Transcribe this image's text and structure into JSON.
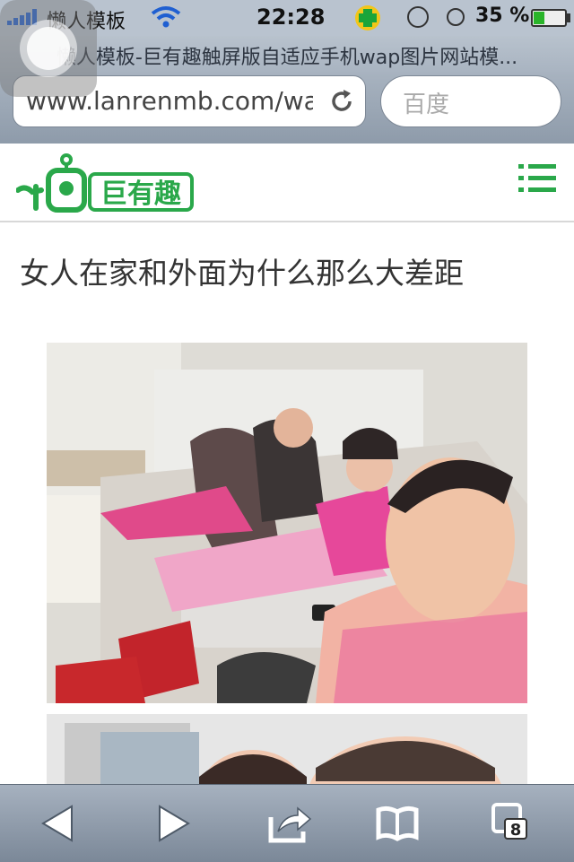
{
  "status_bar": {
    "carrier": "懒人模板",
    "time": "22:28",
    "battery_percent": "35 %",
    "battery_level": 0.35,
    "icons": [
      "signal-icon",
      "wifi-icon",
      "360-security-icon",
      "rotation-lock-icon",
      "alarm-icon",
      "battery-icon"
    ]
  },
  "browser": {
    "page_title": "懒人模板-巨有趣触屏版自适应手机wap图片网站模...",
    "url": "www.lanrenmb.com/wap",
    "search_placeholder": "百度",
    "tab_count": "8"
  },
  "site": {
    "logo_text": "巨有趣",
    "brand_color": "#2aa84a",
    "menu_icon": "hamburger-menu-icon"
  },
  "article": {
    "title": "女人在家和外面为什么那么大差距"
  },
  "toolbar": {
    "icons": [
      "back-icon",
      "forward-icon",
      "share-icon",
      "bookmarks-icon",
      "tabs-icon"
    ]
  }
}
